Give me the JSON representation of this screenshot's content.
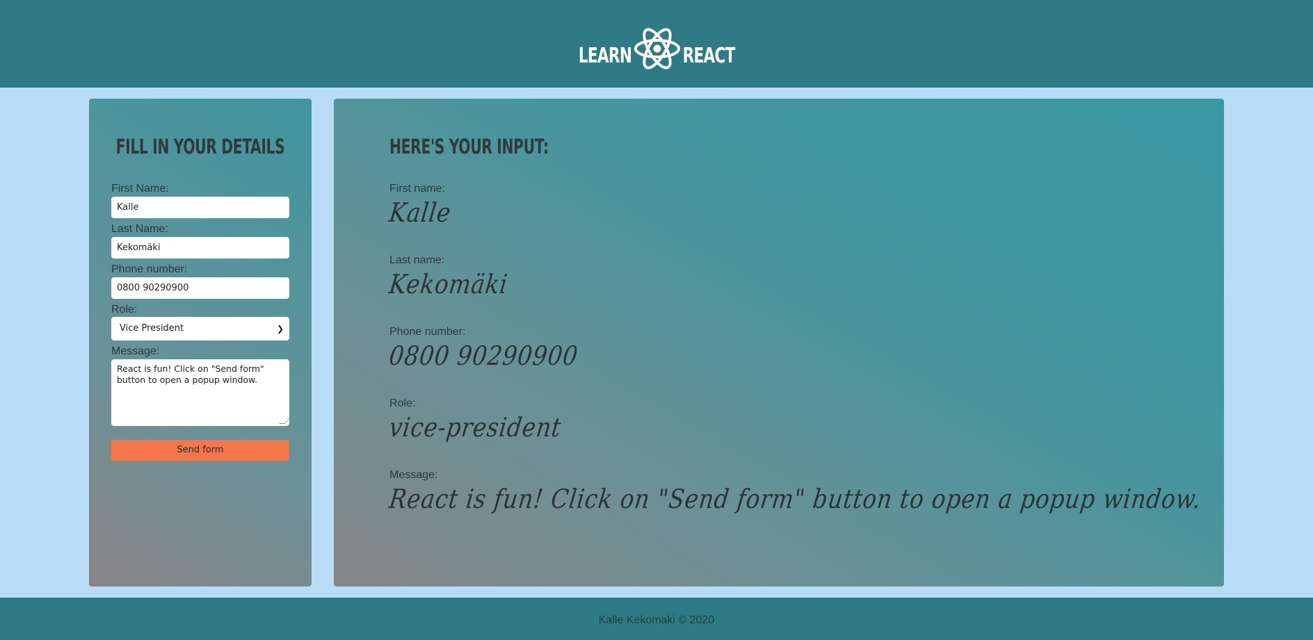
{
  "header": {
    "logo_left": "LEARN",
    "logo_right": "REACT",
    "logo_icon": "react-atom-icon"
  },
  "form": {
    "title": "FILL IN YOUR DETAILS",
    "first_name_label": "First Name:",
    "first_name_value": "Kalle",
    "last_name_label": "Last Name:",
    "last_name_value": "Kekomäki",
    "phone_label": "Phone number:",
    "phone_value": "0800 90290900",
    "role_label": "Role:",
    "role_value": "Vice President",
    "message_label": "Message:",
    "message_value": "React is fun! Click on \"Send form\" button to open a popup window.",
    "submit_label": "Send form"
  },
  "output": {
    "title": "HERE'S YOUR INPUT:",
    "first_name_label": "First name:",
    "first_name_value": "Kalle",
    "last_name_label": "Last name:",
    "last_name_value": "Kekomäki",
    "phone_label": "Phone number:",
    "phone_value": "0800 90290900",
    "role_label": "Role:",
    "role_value": "vice-president",
    "message_label": "Message:",
    "message_value": "React is fun! Click on \"Send form\" button to open a popup window."
  },
  "footer": {
    "text": "Kalle Kekomaki © 2020"
  },
  "colors": {
    "header_bg": "#2e7b85",
    "page_bg": "#b8dcf5",
    "button_bg": "#f3774b"
  }
}
